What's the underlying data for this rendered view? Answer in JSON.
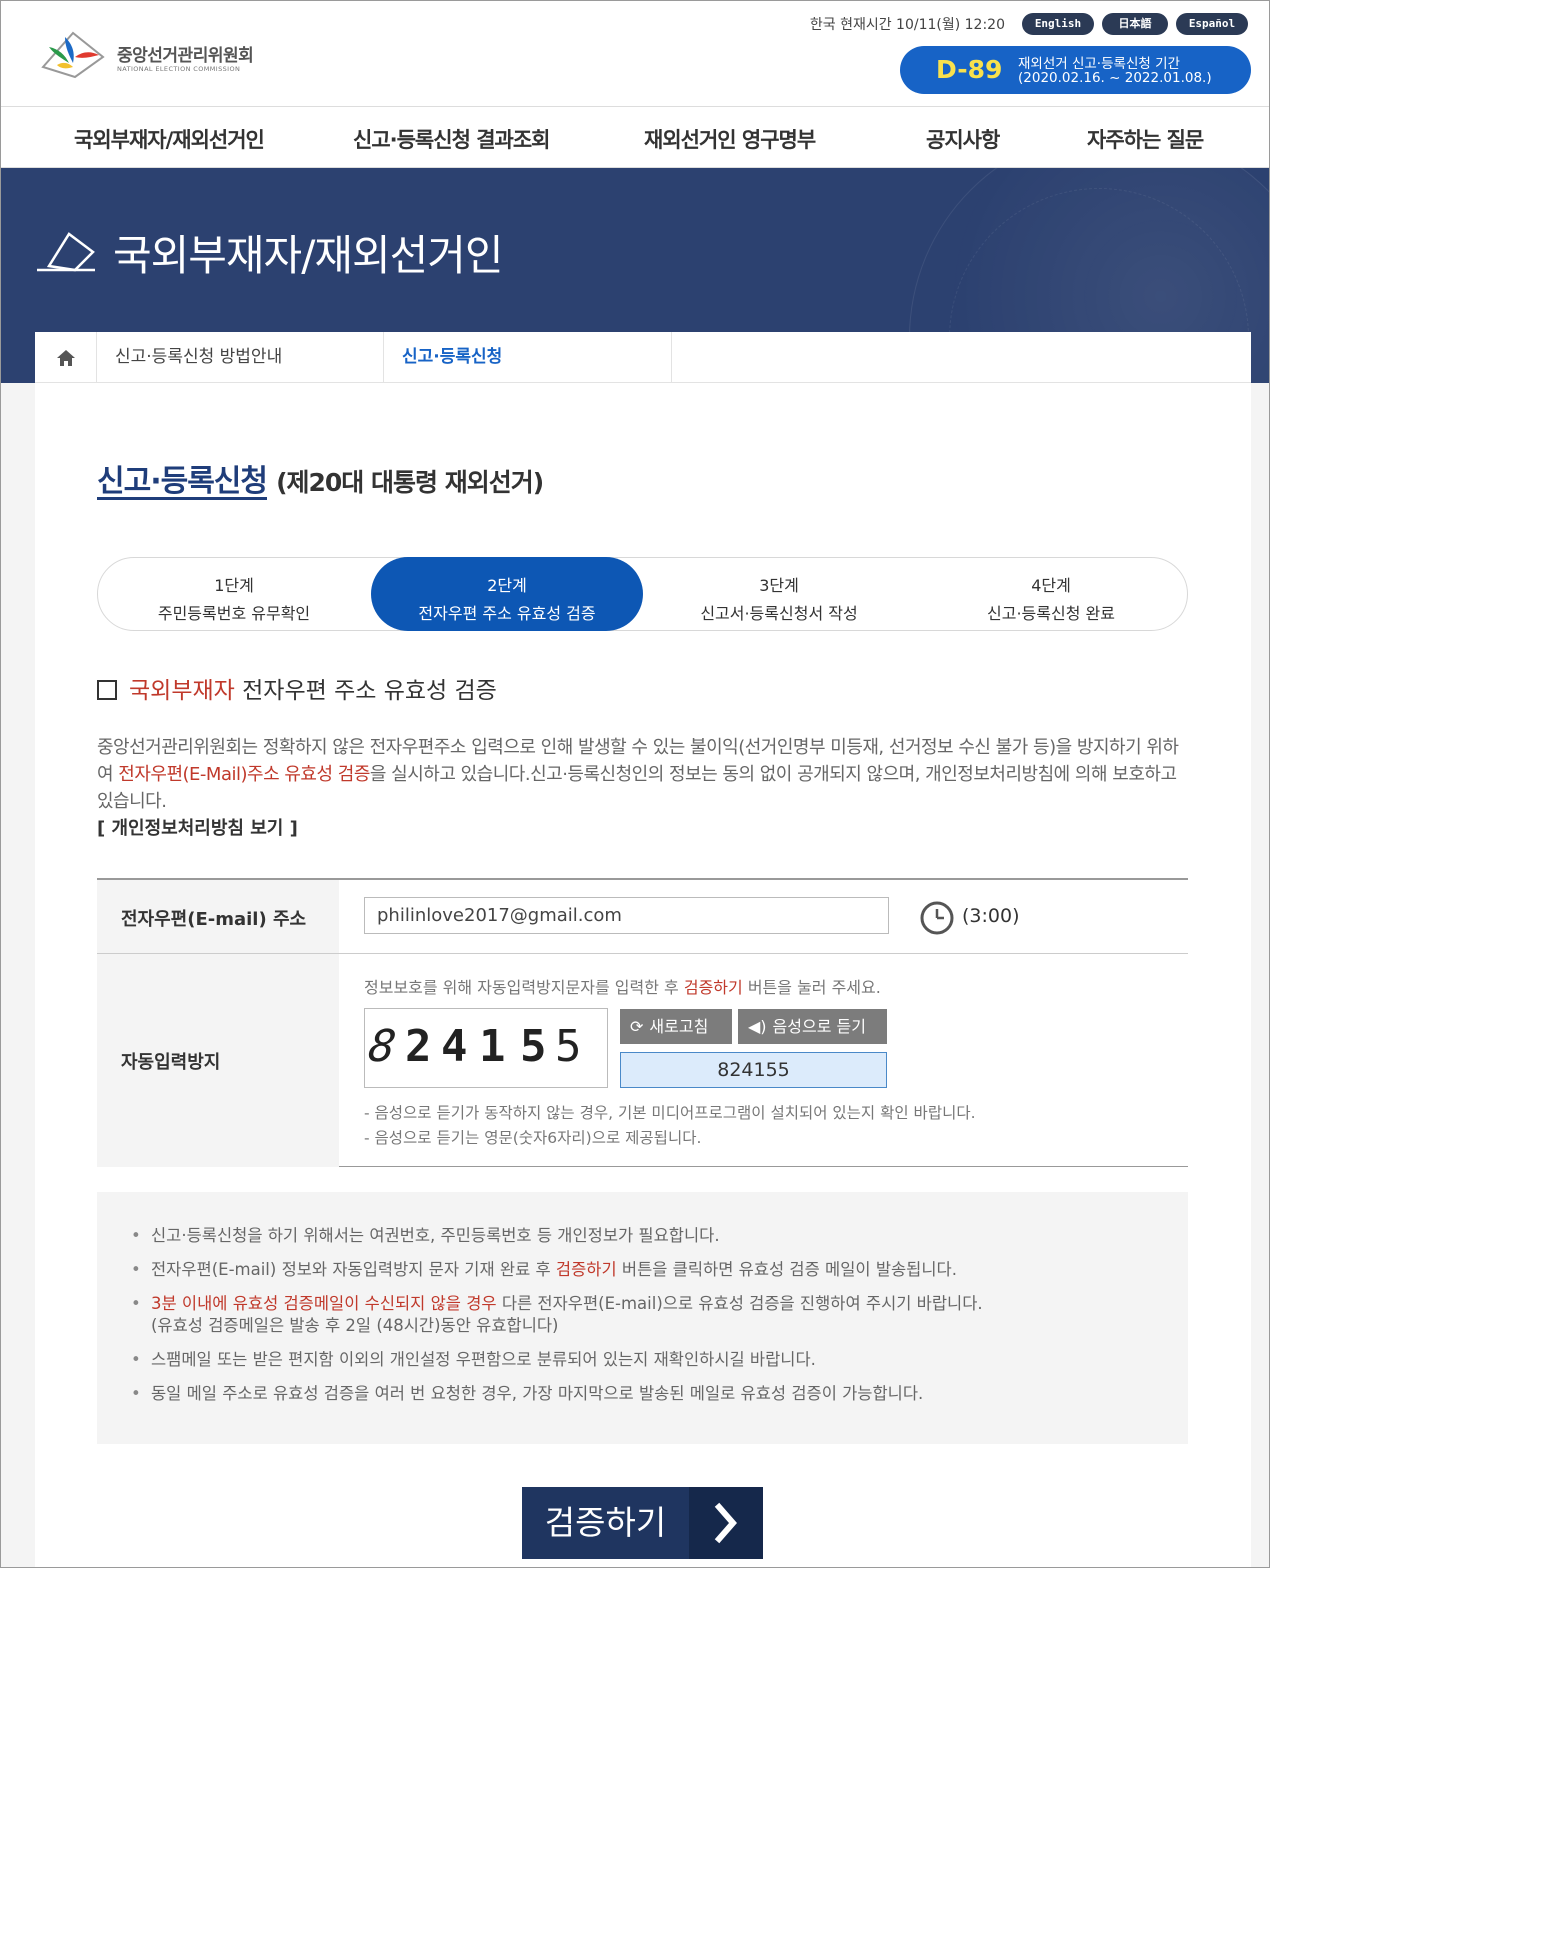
{
  "header": {
    "logo_name": "중앙선거관리위원회",
    "logo_sub": "NATIONAL ELECTION COMMISSION",
    "korea_time": "한국 현재시간 10/11(월) 12:20",
    "languages": [
      "English",
      "日本語",
      "Español"
    ],
    "dday": {
      "count": "D-89",
      "title": "재외선거 신고·등록신청 기간",
      "period": "(2020.02.16. ~ 2022.01.08.)"
    }
  },
  "nav": {
    "items": [
      "국외부재자/재외선거인",
      "신고·등록신청 결과조회",
      "재외선거인 영구명부",
      "공지사항",
      "자주하는 질문"
    ]
  },
  "banner": {
    "title": "국외부재자/재외선거인"
  },
  "breadcrumb": {
    "items": [
      "신고·등록신청 방법안내",
      "신고·등록신청"
    ]
  },
  "page": {
    "title": "신고·등록신청",
    "subtitle": "(제20대 대통령 재외선거)"
  },
  "steps": [
    {
      "num": "1단계",
      "desc": "주민등록번호 유무확인"
    },
    {
      "num": "2단계",
      "desc": "전자우편 주소 유효성 검증"
    },
    {
      "num": "3단계",
      "desc": "신고서·등록신청서 작성"
    },
    {
      "num": "4단계",
      "desc": "신고·등록신청 완료"
    }
  ],
  "section": {
    "heading_red": "국외부재자",
    "heading_rest": " 전자우편 주소 유효성 검증",
    "intro_1": "중앙선거관리위원회는 정확하지 않은 전자우편주소 입력으로 인해 발생할 수 있는 불이익(선거인명부 미등재, 선거정보 수신 불가 등)을 방지하기 위하여 ",
    "intro_red": "전자우편(E-Mail)주소 유효성 검증",
    "intro_2": "을 실시하고 있습니다.신고·등록신청인의 정보는 동의 없이 공개되지 않으며, 개인정보처리방침에 의해 보호하고 있습니다.",
    "privacy_link": "[ 개인정보처리방침 보기 ]"
  },
  "form": {
    "email_label": "전자우편(E-mail) 주소",
    "email_value": "philinlove2017@gmail.com",
    "timer": "(3:00)",
    "captcha_label": "자동입력방지",
    "captcha_note_1": "정보보호를 위해 자동입력방지문자를 입력한 후 ",
    "captcha_note_red": "검증하기",
    "captcha_note_2": " 버튼을 눌러 주세요.",
    "captcha_digits": [
      "8",
      "2",
      "4",
      "1",
      "5",
      "5"
    ],
    "refresh_label": "새로고침",
    "audio_label": "음성으로 듣기",
    "captcha_value": "824155",
    "note_1": "- 음성으로 듣기가 동작하지 않는 경우, 기본 미디어프로그램이 설치되어 있는지 확인 바랍니다.",
    "note_2": "- 음성으로 듣기는 영문(숫자6자리)으로 제공됩니다."
  },
  "info": {
    "item_1": "신고·등록신청을 하기 위해서는 여권번호, 주민등록번호 등 개인정보가 필요합니다.",
    "item_2a": "전자우편(E-mail) 정보와 자동입력방지 문자 기재 완료 후 ",
    "item_2red": "검증하기",
    "item_2b": " 버튼을 클릭하면 유효성 검증 메일이 발송됩니다.",
    "item_3red": "3분 이내에 유효성 검증메일이 수신되지 않을 경우",
    "item_3a": " 다른 전자우편(E-mail)으로 유효성 검증을 진행하여 주시기 바랍니다.",
    "item_3b": "(유효성 검증메일은 발송 후 2일 (48시간)동안 유효합니다)",
    "item_4": "스팸메일 또는 받은 편지함 이외의 개인설정 우편함으로 분류되어 있는지 재확인하시길 바랍니다.",
    "item_5": "동일 메일 주소로 유효성 검증을 여러 번 요청한 경우, 가장 마지막으로 발송된 메일로 유효성 검증이 가능합니다."
  },
  "submit": {
    "label": "검증하기"
  },
  "colors": {
    "brand_navy": "#2c4170",
    "primary_blue": "#0d57b4",
    "accent_red": "#c0392b",
    "dday_yellow": "#f9e14c"
  }
}
